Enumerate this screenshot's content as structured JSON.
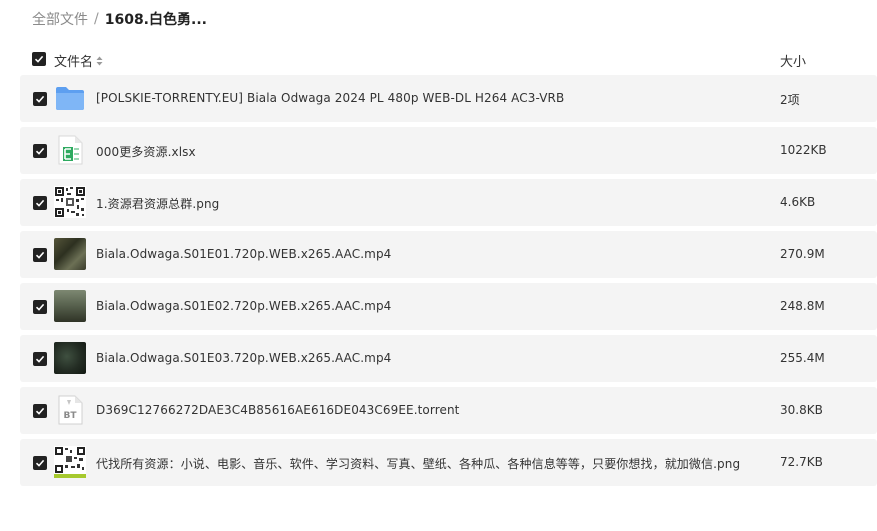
{
  "breadcrumb": {
    "root": "全部文件",
    "separator": "/",
    "current": "1608.白色勇..."
  },
  "header": {
    "name_label": "文件名",
    "size_label": "大小"
  },
  "colors": {
    "row_bg": "#f4f4f4",
    "checkbox": "#222222",
    "folder": "#6aaaf2",
    "excel": "#2eaa60"
  },
  "files": [
    {
      "name": "[POLSKIE-TORRENTY.EU] Biala Odwaga 2024 PL 480p WEB-DL H264 AC3-VRB",
      "size": "2项",
      "icon": "folder-icon",
      "checked": true
    },
    {
      "name": "000更多资源.xlsx",
      "size": "1022KB",
      "icon": "excel-file-icon",
      "checked": true
    },
    {
      "name": "1.资源君资源总群.png",
      "size": "4.6KB",
      "icon": "qr-code-image-icon",
      "checked": true
    },
    {
      "name": "Biala.Odwaga.S01E01.720p.WEB.x265.AAC.mp4",
      "size": "270.9M",
      "icon": "video-thumbnail",
      "checked": true
    },
    {
      "name": "Biala.Odwaga.S01E02.720p.WEB.x265.AAC.mp4",
      "size": "248.8M",
      "icon": "video-thumbnail",
      "checked": true
    },
    {
      "name": "Biala.Odwaga.S01E03.720p.WEB.x265.AAC.mp4",
      "size": "255.4M",
      "icon": "video-thumbnail",
      "checked": true
    },
    {
      "name": "D369C12766272DAE3C4B85616AE616DE043C69EE.torrent",
      "size": "30.8KB",
      "icon": "torrent-file-icon",
      "checked": true,
      "icon_text": "BT"
    },
    {
      "name": "代找所有资源：小说、电影、音乐、软件、学习资料、写真、壁纸、各种瓜、各种信息等等，只要你想找，就加微信.png",
      "size": "72.7KB",
      "icon": "qr-code-image-icon",
      "checked": true
    }
  ]
}
